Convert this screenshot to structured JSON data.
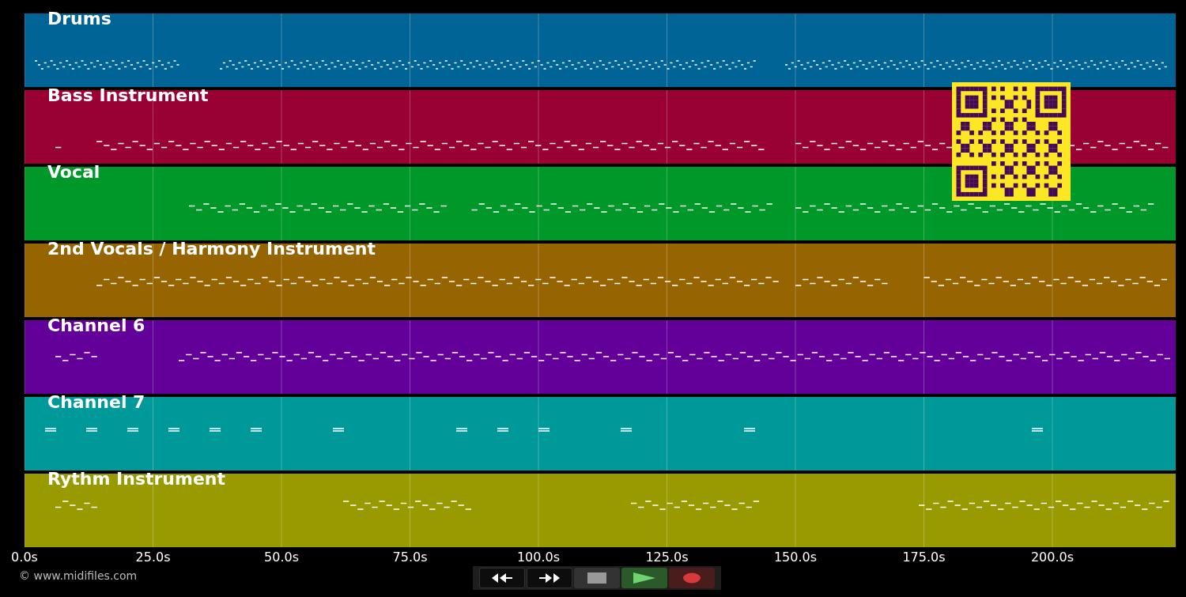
{
  "tracks": [
    {
      "name": "Drums",
      "color": "#006496"
    },
    {
      "name": "Bass Instrument",
      "color": "#990033"
    },
    {
      "name": "Vocal",
      "color": "#009929"
    },
    {
      "name": "2nd Vocals / Harmony Instrument",
      "color": "#966400"
    },
    {
      "name": "Channel 6",
      "color": "#630099"
    },
    {
      "name": "Channel 7",
      "color": "#009999"
    },
    {
      "name": "Rythm Instrument",
      "color": "#999900"
    }
  ],
  "time_axis": {
    "ticks": [
      "0.0s",
      "25.0s",
      "50.0s",
      "75.0s",
      "100.0s",
      "125.0s",
      "150.0s",
      "175.0s",
      "200.0s"
    ]
  },
  "transport": [
    {
      "kind": "rewind"
    },
    {
      "kind": "fast-forward"
    },
    {
      "kind": "stop"
    },
    {
      "kind": "play"
    },
    {
      "kind": "record"
    }
  ],
  "copyright": "© www.midifiles.com"
}
